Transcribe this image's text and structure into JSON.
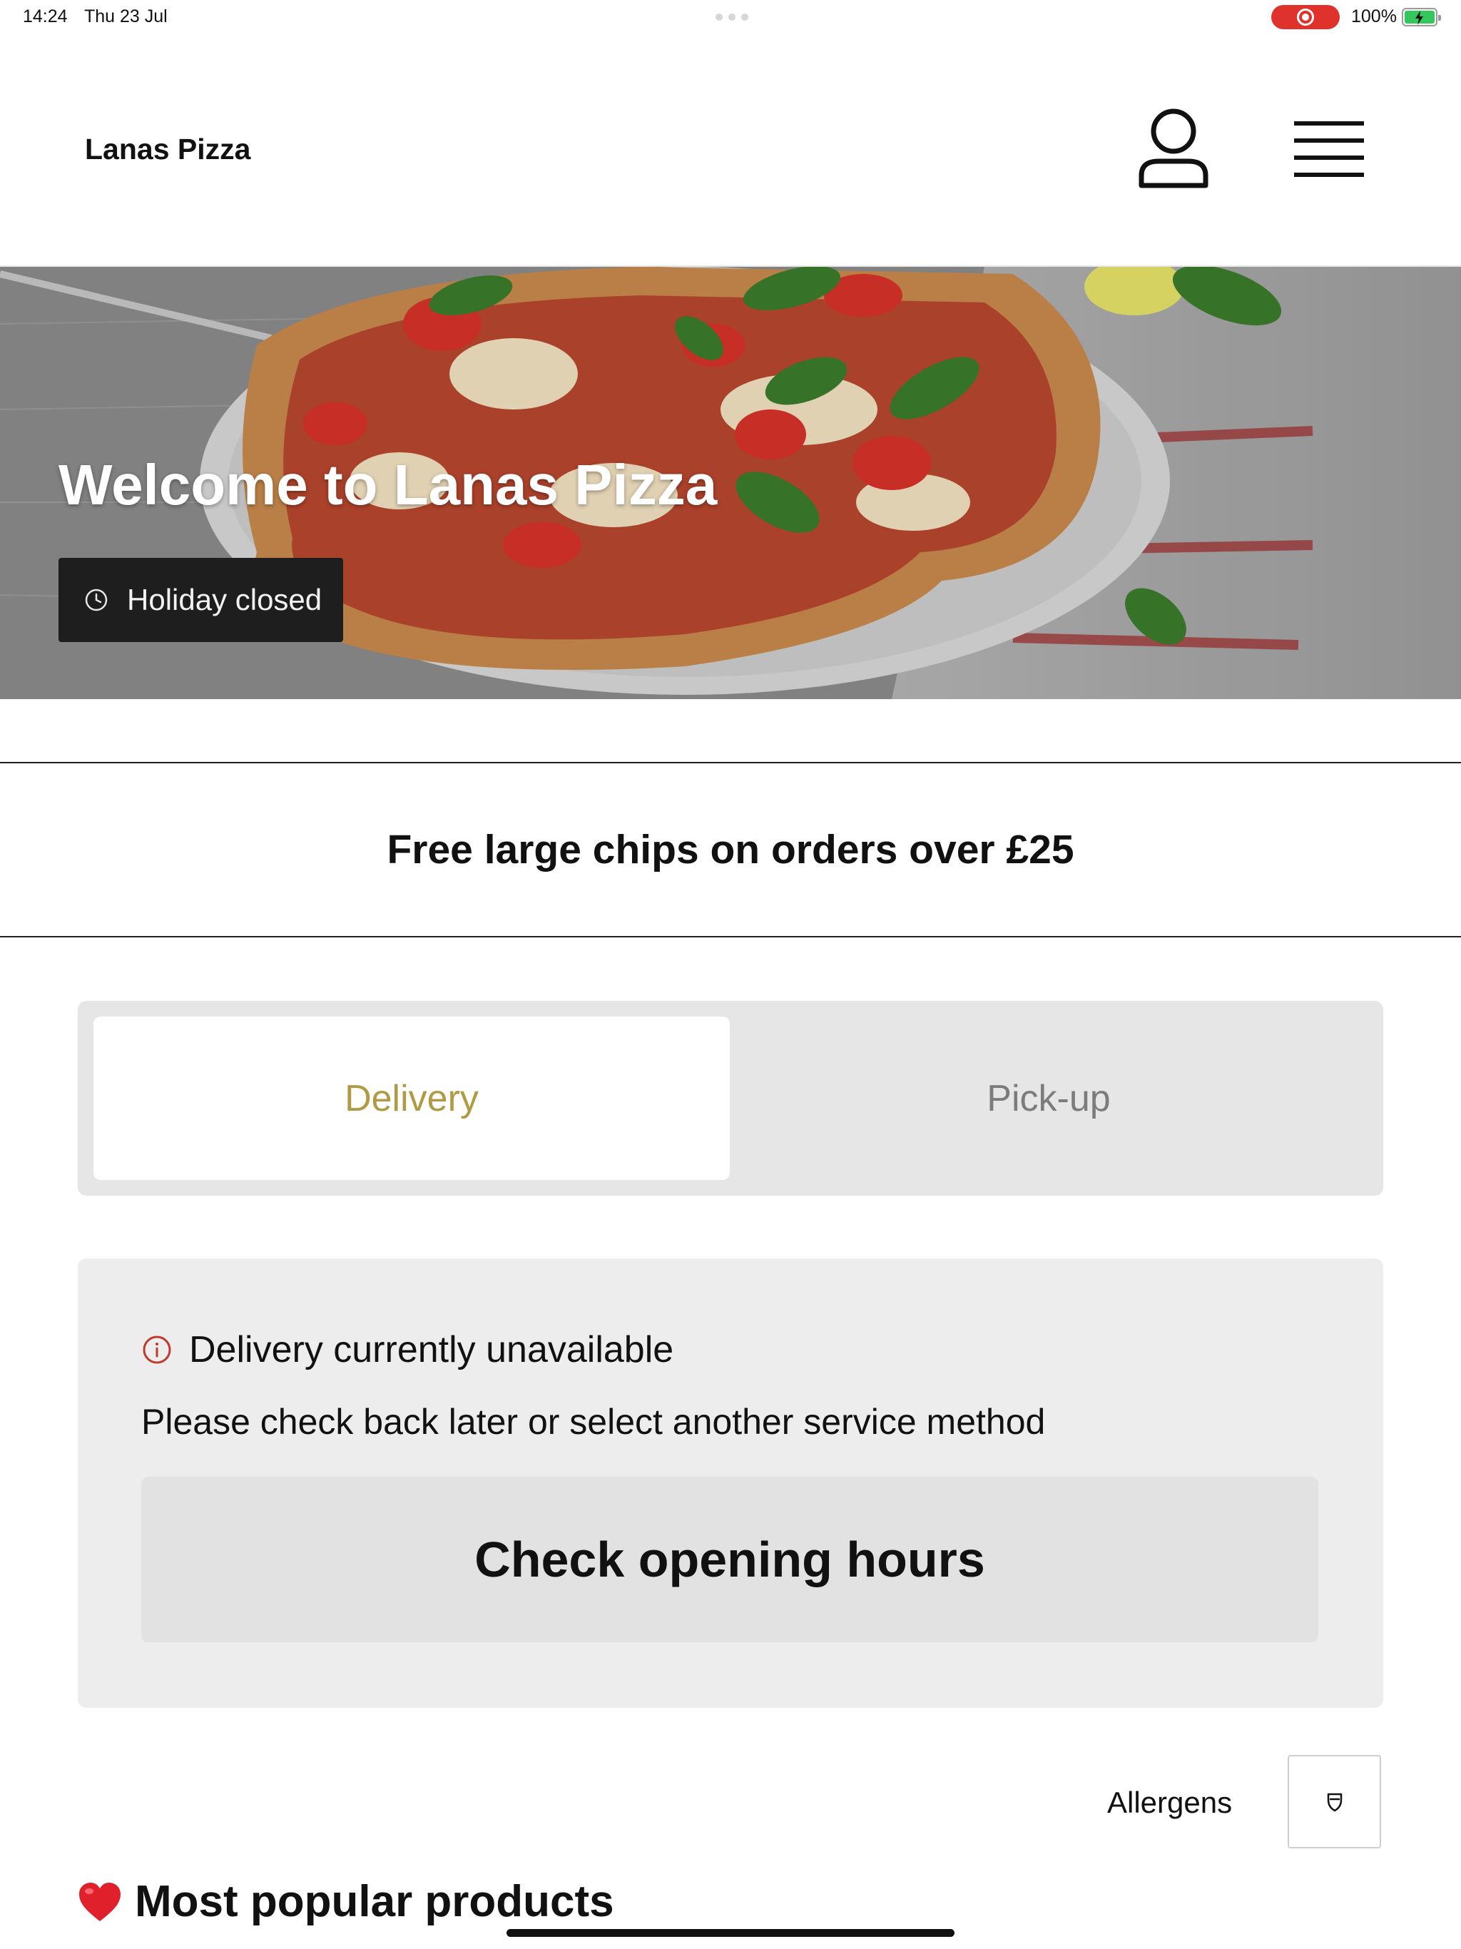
{
  "status_bar": {
    "time": "14:24",
    "date": "Thu 23 Jul",
    "battery_percent": "100%"
  },
  "header": {
    "brand": "Lanas Pizza",
    "account_icon": "user-icon",
    "menu_icon": "hamburger-menu-icon"
  },
  "hero": {
    "title": "Welcome to Lanas Pizza",
    "status_icon": "clock-icon",
    "status_label": "Holiday closed"
  },
  "promo": {
    "text": "Free large chips on orders over £25"
  },
  "service_toggle": {
    "options": [
      {
        "label": "Delivery",
        "selected": true
      },
      {
        "label": "Pick-up",
        "selected": false
      }
    ],
    "active_color": "#b29a45"
  },
  "notice": {
    "icon": "info-icon",
    "icon_color": "#c0392b",
    "title": "Delivery currently unavailable",
    "body": "Please check back later or select another service method",
    "button_label": "Check opening hours"
  },
  "allergens": {
    "label": "Allergens",
    "icon": "shield-filter-icon"
  },
  "section": {
    "icon": "heart-icon",
    "title": "Most popular products"
  },
  "colors": {
    "record_indicator": "#e0322d",
    "battery_fill": "#34c759"
  }
}
